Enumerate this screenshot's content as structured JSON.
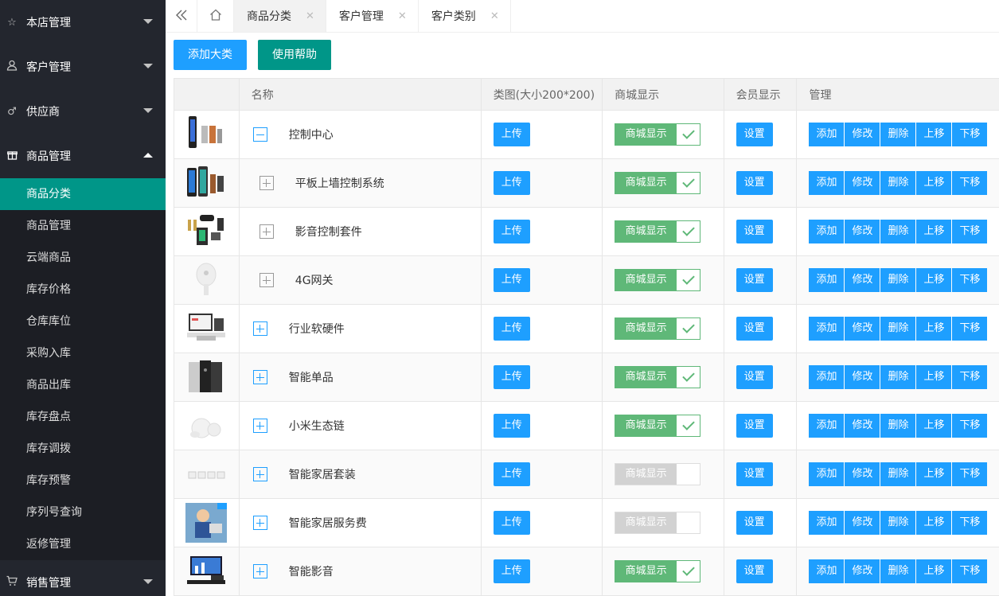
{
  "sidebar": {
    "groups": [
      {
        "label": "本店管理",
        "icon": "star-icon"
      },
      {
        "label": "客户管理",
        "icon": "user-icon"
      },
      {
        "label": "供应商",
        "icon": "male-icon"
      },
      {
        "label": "商品管理",
        "icon": "gift-icon"
      }
    ],
    "sub_items": [
      "商品分类",
      "商品管理",
      "云端商品",
      "库存价格",
      "仓库库位",
      "采购入库",
      "商品出库",
      "库存盘点",
      "库存调拨",
      "库存预警",
      "序列号查询",
      "返修管理"
    ],
    "bottom_group": {
      "label": "销售管理",
      "icon": "cart-icon"
    }
  },
  "tabs": [
    {
      "label": "商品分类"
    },
    {
      "label": "客户管理"
    },
    {
      "label": "客户类别"
    }
  ],
  "toolbar": {
    "add_label": "添加大类",
    "help_label": "使用帮助"
  },
  "table": {
    "headers": [
      "名称",
      "类图(大小200*200)",
      "商城显示",
      "会员显示",
      "管理"
    ],
    "upload_label": "上传",
    "setting_label": "设置",
    "switch_label": "商城显示",
    "actions": [
      "添加",
      "修改",
      "删除",
      "上移",
      "下移"
    ],
    "rows": [
      {
        "name": "控制中心",
        "level": 0,
        "expanded": true,
        "shop": true
      },
      {
        "name": "平板上墙控制系统",
        "level": 1,
        "expanded": false,
        "shop": true
      },
      {
        "name": "影音控制套件",
        "level": 1,
        "expanded": false,
        "shop": true
      },
      {
        "name": "4G网关",
        "level": 1,
        "expanded": false,
        "shop": true
      },
      {
        "name": "行业软硬件",
        "level": 0,
        "expanded": false,
        "shop": true
      },
      {
        "name": "智能单品",
        "level": 0,
        "expanded": false,
        "shop": true
      },
      {
        "name": "小米生态链",
        "level": 0,
        "expanded": false,
        "shop": true
      },
      {
        "name": "智能家居套装",
        "level": 0,
        "expanded": false,
        "shop": false
      },
      {
        "name": "智能家居服务费",
        "level": 0,
        "expanded": false,
        "shop": false
      },
      {
        "name": "智能影音",
        "level": 0,
        "expanded": false,
        "shop": true
      }
    ]
  },
  "colors": {
    "sidebar_bg": "#23262e",
    "active": "#009688",
    "primary": "#1e9fff",
    "switch_on": "#5fb878",
    "switch_off": "#d2d2d2"
  }
}
